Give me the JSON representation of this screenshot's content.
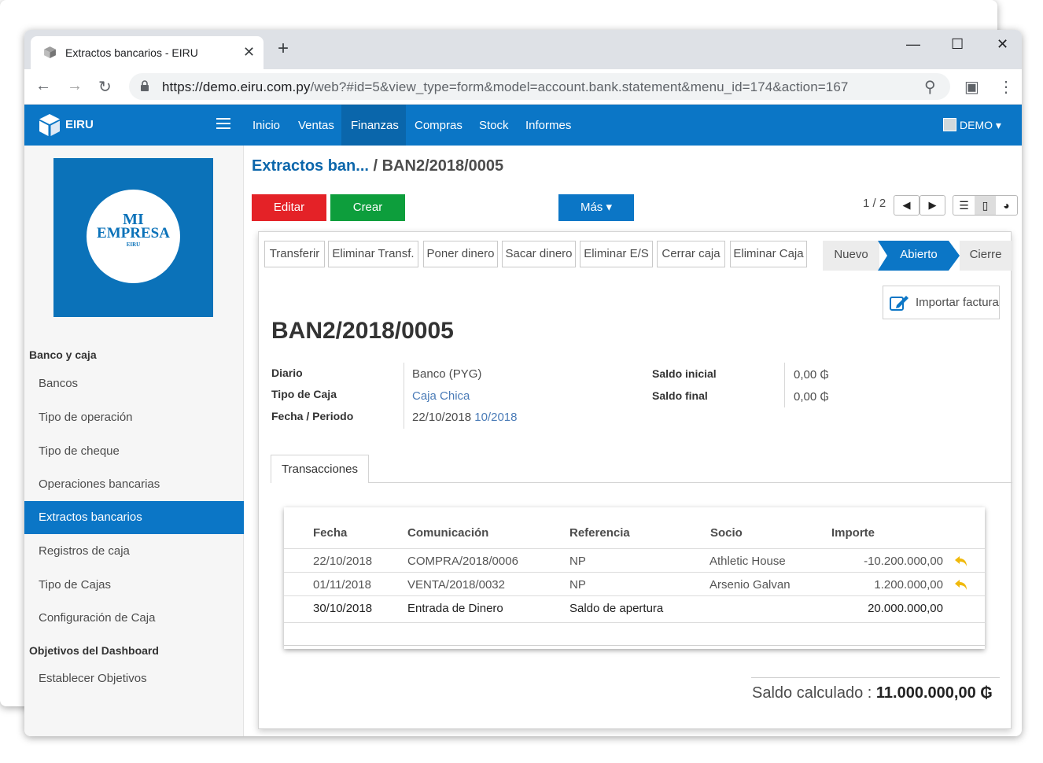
{
  "browser": {
    "tab_title": "Extractos bancarios - EIRU",
    "url_host": "https://demo.eiru.com.py",
    "url_path": "/web?#id=5&view_type=form&model=account.bank.statement&menu_id=174&action=167"
  },
  "navbar": {
    "brand": "EIRU",
    "menu": [
      "Inicio",
      "Ventas",
      "Finanzas",
      "Compras",
      "Stock",
      "Informes"
    ],
    "active_menu": "Finanzas",
    "user": "DEMO"
  },
  "sidebar": {
    "logo_line1": "MI",
    "logo_line2": "EMPRESA",
    "logo_line3": "EIRU",
    "section1": "Banco y caja",
    "items1": [
      "Bancos",
      "Tipo de operación",
      "Tipo de cheque",
      "Operaciones bancarias",
      "Extractos bancarios",
      "Registros de caja",
      "Tipo de Cajas",
      "Configuración de Caja"
    ],
    "active_item": "Extractos bancarios",
    "section2": "Objetivos del Dashboard",
    "items2": [
      "Establecer Objetivos"
    ]
  },
  "breadcrumb": {
    "parent": "Extractos ban...",
    "current": "/ BAN2/2018/0005"
  },
  "buttons": {
    "edit": "Editar",
    "create": "Crear",
    "more": "Más ▾"
  },
  "pager": "1 / 2",
  "statusbar": {
    "actions": [
      "Transferir",
      "Eliminar Transf.",
      "Poner dinero",
      "Sacar dinero",
      "Eliminar E/S",
      "Cerrar caja",
      "Eliminar Caja"
    ],
    "stages": [
      "Nuevo",
      "Abierto",
      "Cierre"
    ],
    "active_stage": "Abierto"
  },
  "import_button": "Importar factura",
  "record": {
    "title": "BAN2/2018/0005",
    "diario_label": "Diario",
    "diario_value": "Banco (PYG)",
    "tipo_caja_label": "Tipo de Caja",
    "tipo_caja_value": "Caja Chica",
    "fecha_label": "Fecha / Periodo",
    "fecha_value": "22/10/2018",
    "periodo_value": "10/2018",
    "saldo_inicial_label": "Saldo inicial",
    "saldo_inicial_value": "0,00 ₲",
    "saldo_final_label": "Saldo final",
    "saldo_final_value": "0,00 ₲"
  },
  "notebook_tab": "Transacciones",
  "table": {
    "headers": [
      "Fecha",
      "Comunicación",
      "Referencia",
      "Socio",
      "Importe"
    ],
    "rows": [
      {
        "fecha": "22/10/2018",
        "comunicacion": "COMPRA/2018/0006",
        "referencia": "NP",
        "socio": "Athletic House",
        "importe": "-10.200.000,00"
      },
      {
        "fecha": "01/11/2018",
        "comunicacion": "VENTA/2018/0032",
        "referencia": "NP",
        "socio": "Arsenio Galvan",
        "importe": "1.200.000,00"
      },
      {
        "fecha": "30/10/2018",
        "comunicacion": "Entrada de Dinero",
        "referencia": "Saldo de apertura",
        "socio": "",
        "importe": "20.000.000,00"
      }
    ]
  },
  "total": {
    "label": "Saldo calculado :",
    "value": "11.000.000,00 ₲"
  },
  "colors": {
    "primary": "#0b76c6",
    "edit": "#e42227",
    "create": "#0d9e3c",
    "link": "#4a7bb7"
  }
}
